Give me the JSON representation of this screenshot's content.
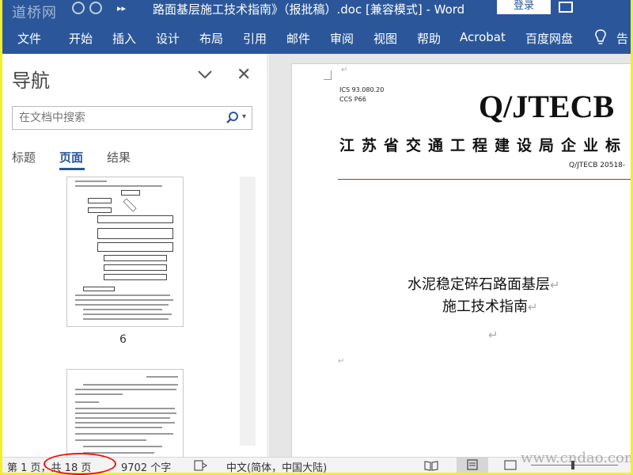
{
  "titlebar": {
    "watermark_logo": "道桥网",
    "document_title": "路面基层施工技术指南》（报批稿）.doc [兼容模式] - Word",
    "login_label": "登录"
  },
  "menu": {
    "items": [
      "文件",
      "开始",
      "插入",
      "设计",
      "布局",
      "引用",
      "邮件",
      "审阅",
      "视图",
      "帮助",
      "Acrobat",
      "百度网盘",
      "告"
    ]
  },
  "nav": {
    "title": "导航",
    "search_placeholder": "在文档中搜索",
    "tabs": [
      "标题",
      "页面",
      "结果"
    ],
    "active_tab": "页面",
    "page_number": "6"
  },
  "document": {
    "ics": "ICS 93.080.20",
    "ccs": "CCS P66",
    "standard_code": "Q/JTECB",
    "organization": "江苏省交通工程建设局企业标",
    "standard_number": "Q/JTECB 20518-",
    "title_line1": "水泥稳定碎石路面基层",
    "title_line2": "施工技术指南",
    "paragraph_mark": "↵"
  },
  "status": {
    "page": "第 1 页，共 18 页",
    "word_count": "9702 个字",
    "language": "中文(简体，中国大陆)"
  },
  "site_watermark": "www.cndao.com",
  "colors": {
    "ribbon": "#2b579a",
    "border_frame": "#f2ee2a",
    "annotation_red": "#e11111"
  }
}
